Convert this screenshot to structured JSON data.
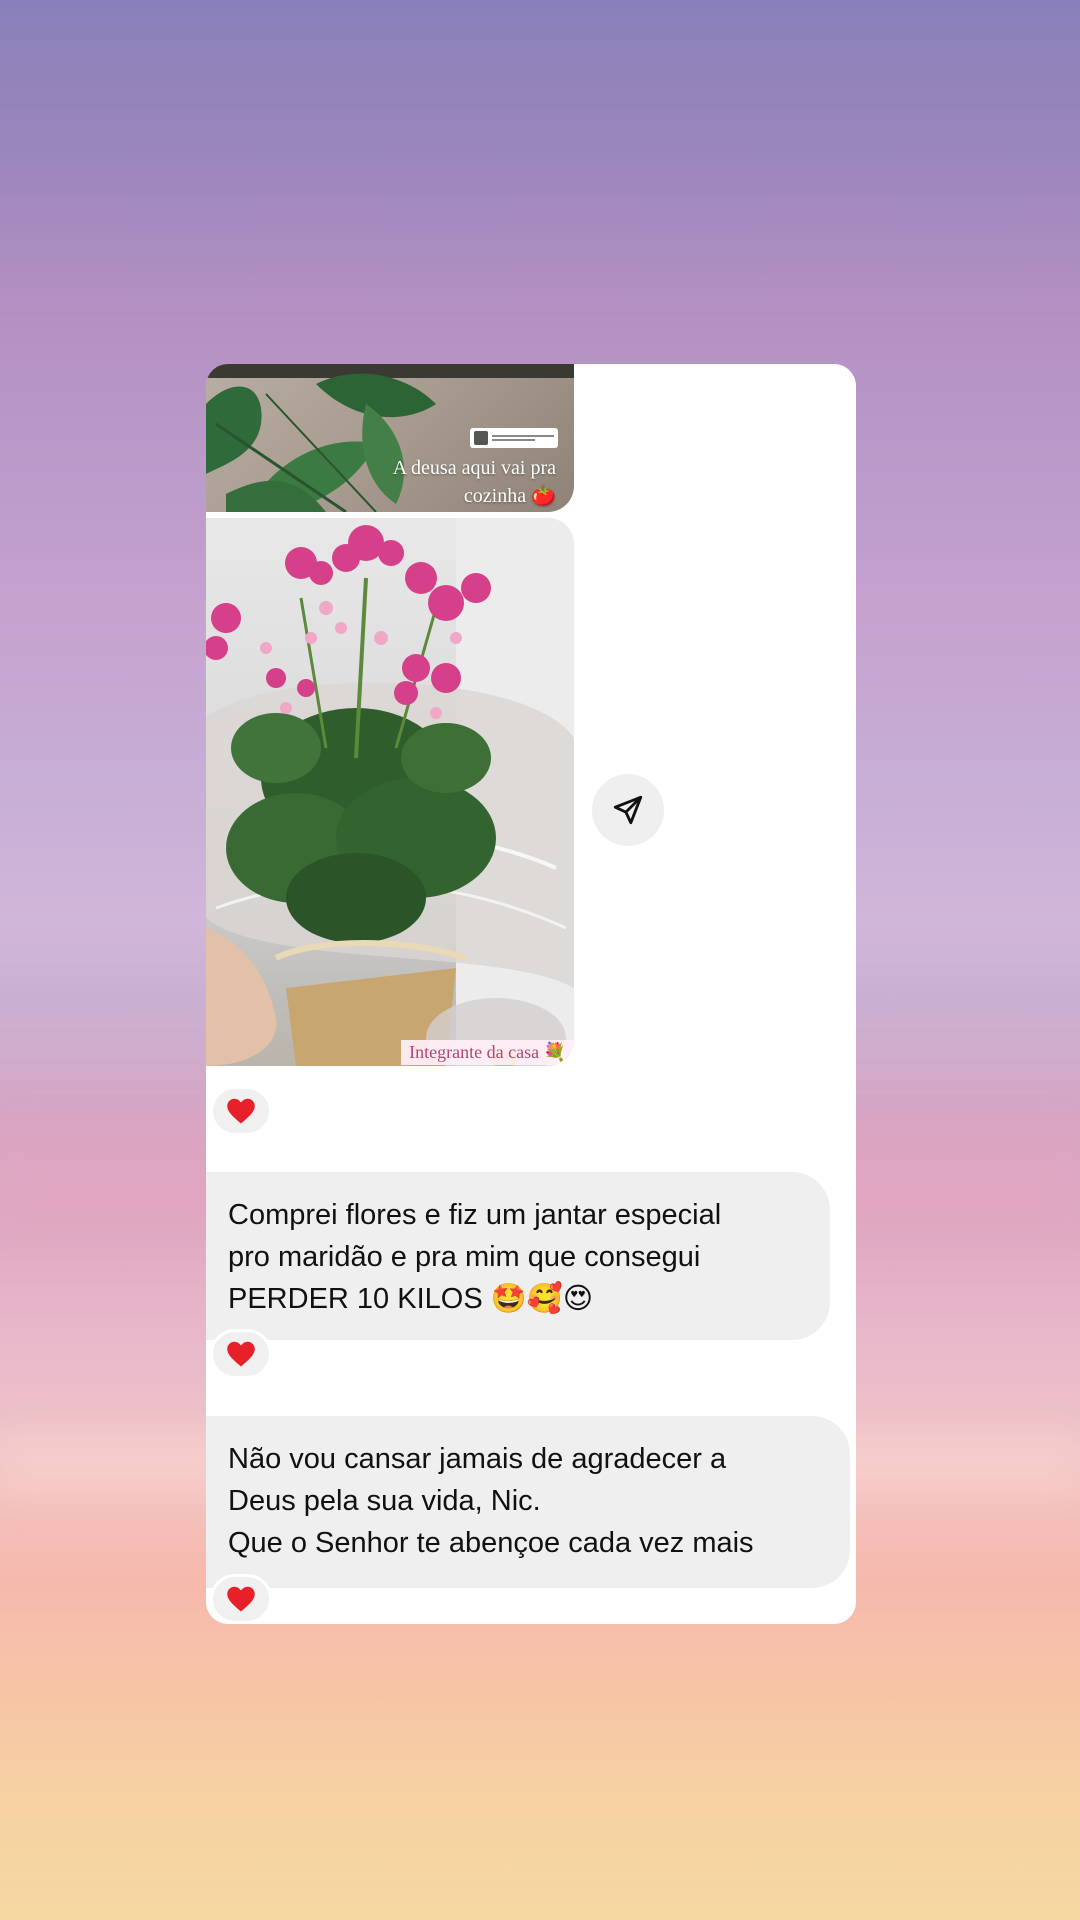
{
  "story_reply_top": {
    "caption_line1": "A deusa aqui vai pra",
    "caption_line2": "cozinha 🍅"
  },
  "story_reply_main": {
    "caption": "Integrante da casa 💐"
  },
  "share": {
    "icon": "paper-plane-icon"
  },
  "reactions": {
    "emoji": "❤️",
    "color": "#e8202a"
  },
  "messages": [
    {
      "line1": "Comprei flores e fiz um jantar especial",
      "line2": "pro maridão e pra mim que consegui",
      "line3": "PERDER 10 KILOS 🤩🥰😍"
    },
    {
      "line1": "Não vou cansar jamais de agradecer a",
      "line2": "Deus pela sua vida, Nic.",
      "line3": "Que o Senhor te abençoe cada vez mais"
    }
  ],
  "colors": {
    "bubble": "#efefef",
    "card": "#ffffff",
    "caption_pink": "#b34573"
  }
}
